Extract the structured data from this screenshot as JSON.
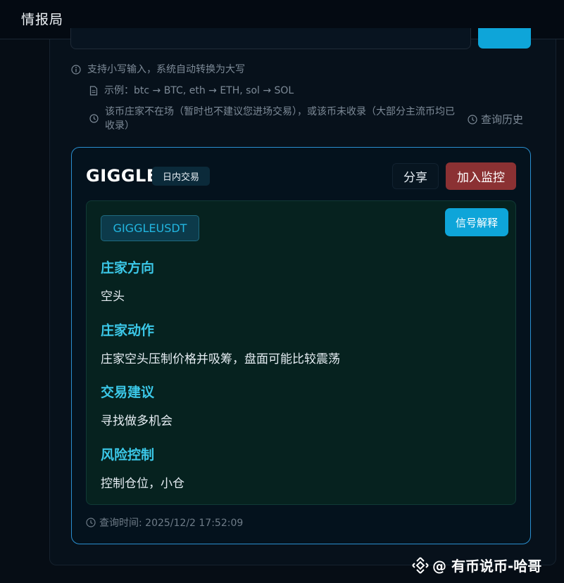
{
  "app": {
    "title": "情报局"
  },
  "hints": {
    "lowercase": "支持小写输入，系统自动转换为大写",
    "example": "示例：btc → BTC, eth → ETH, sol → SOL",
    "notice": "该币庄家不在场（暂时也不建议您进场交易），或该币未收录（大部分主流币均已收录）",
    "history_label": "查询历史"
  },
  "result": {
    "coin": "GIGGLE",
    "mode_badge": "日内交易",
    "share_label": "分享",
    "watch_label": "加入监控",
    "symbol": "GIGGLEUSDT",
    "explain_label": "信号解释",
    "sections": [
      {
        "title": "庄家方向",
        "value": "空头"
      },
      {
        "title": "庄家动作",
        "value": "庄家空头压制价格并吸筹，盘面可能比较震荡"
      },
      {
        "title": "交易建议",
        "value": "寻找做多机会"
      },
      {
        "title": "风险控制",
        "value": "控制仓位，小仓"
      }
    ],
    "query_time": "查询时间: 2025/12/2 17:52:09"
  },
  "watermark": {
    "text": "@ 有币说币-哈哥"
  },
  "colors": {
    "accent": "#0ea5d9",
    "danger": "#8b3133",
    "section_title": "#3bc8e8",
    "card_border": "#2a8fd0"
  }
}
